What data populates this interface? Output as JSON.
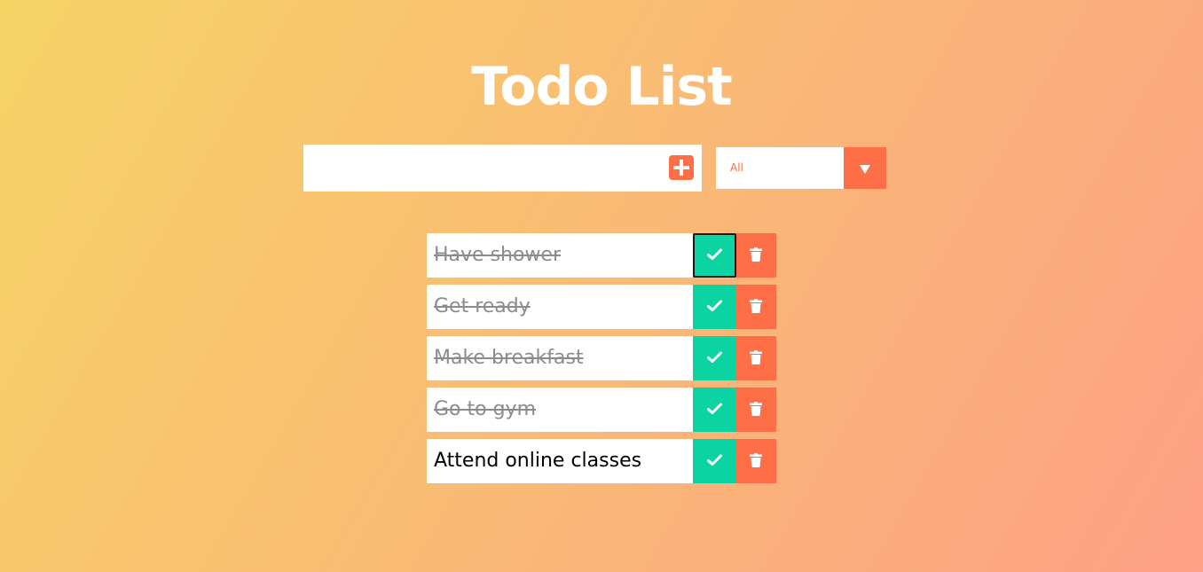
{
  "header": {
    "title": "Todo List"
  },
  "form": {
    "input_value": "",
    "input_placeholder": "",
    "add_icon": "plus-square-icon",
    "filter": {
      "selected": "All",
      "arrow_icon": "caret-down-icon"
    }
  },
  "todos": [
    {
      "text": "Have shower",
      "completed": true
    },
    {
      "text": "Get ready",
      "completed": true
    },
    {
      "text": "Make breakfast",
      "completed": true
    },
    {
      "text": "Go to gym",
      "completed": true
    },
    {
      "text": "Attend online classes",
      "completed": false
    }
  ],
  "icons": {
    "complete": "check-icon",
    "delete": "trash-icon"
  },
  "colors": {
    "gradient_start": "#f6d365",
    "gradient_end": "#fda085",
    "accent": "#ff6f47",
    "complete": "#0bd4a2",
    "completed_text": "#8c8c8c"
  }
}
